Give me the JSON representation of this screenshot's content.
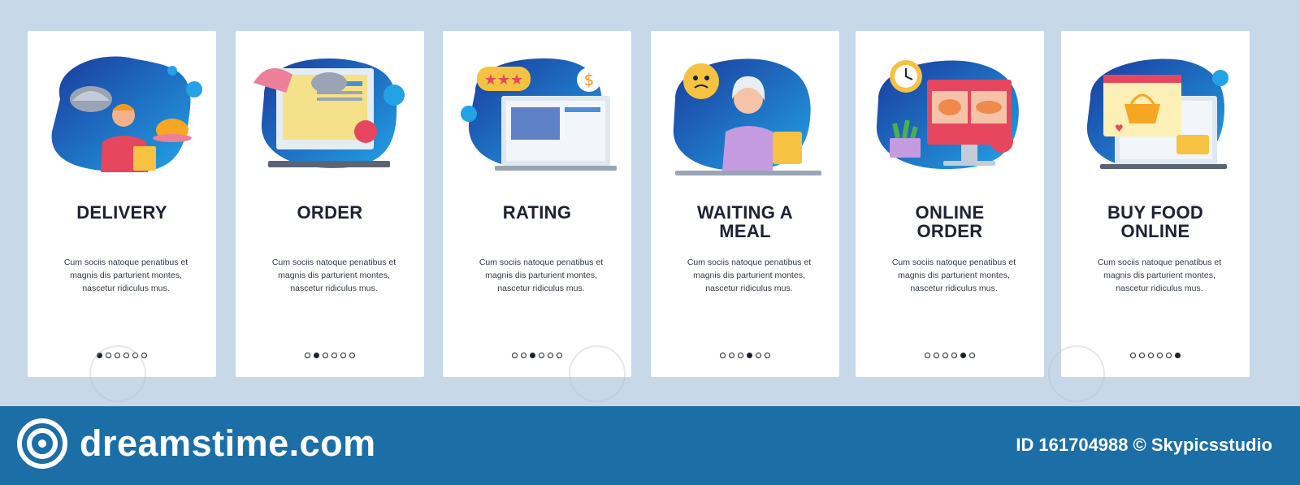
{
  "cards": [
    {
      "title": "DELIVERY",
      "body": "Cum sociis natoque penatibus et magnis dis parturient montes, nascetur ridiculus mus.",
      "active_dot": 1,
      "icon": "courier-icon"
    },
    {
      "title": "ORDER",
      "body": "Cum sociis natoque penatibus et magnis dis parturient montes, nascetur ridiculus mus.",
      "active_dot": 2,
      "icon": "computer-order-icon"
    },
    {
      "title": "RATING",
      "body": "Cum sociis natoque penatibus et magnis dis parturient montes, nascetur ridiculus mus.",
      "active_dot": 3,
      "icon": "laptop-rating-icon"
    },
    {
      "title": "WAITING A\nMEAL",
      "body": "Cum sociis natoque penatibus et magnis dis parturient montes, nascetur ridiculus mus.",
      "active_dot": 4,
      "icon": "hungry-woman-icon"
    },
    {
      "title": "ONLINE\nORDER",
      "body": "Cum sociis natoque penatibus et magnis dis parturient montes, nascetur ridiculus mus.",
      "active_dot": 5,
      "icon": "monitor-fish-icon"
    },
    {
      "title": "BUY FOOD\nONLINE",
      "body": "Cum sociis natoque penatibus et magnis dis parturient montes, nascetur ridiculus mus.",
      "active_dot": 6,
      "icon": "laptop-basket-icon"
    }
  ],
  "dots_count": 6,
  "footer": {
    "brand": "dreamstime.com",
    "id_label": "ID",
    "id_value": "161704988",
    "copyright": "© Skypicsstudio"
  },
  "colors": {
    "background": "#c7d9e8",
    "footer": "#1c6ea7",
    "blob_dark": "#1a3a9c",
    "blob_light": "#23a3e6",
    "title": "#1c2133"
  }
}
